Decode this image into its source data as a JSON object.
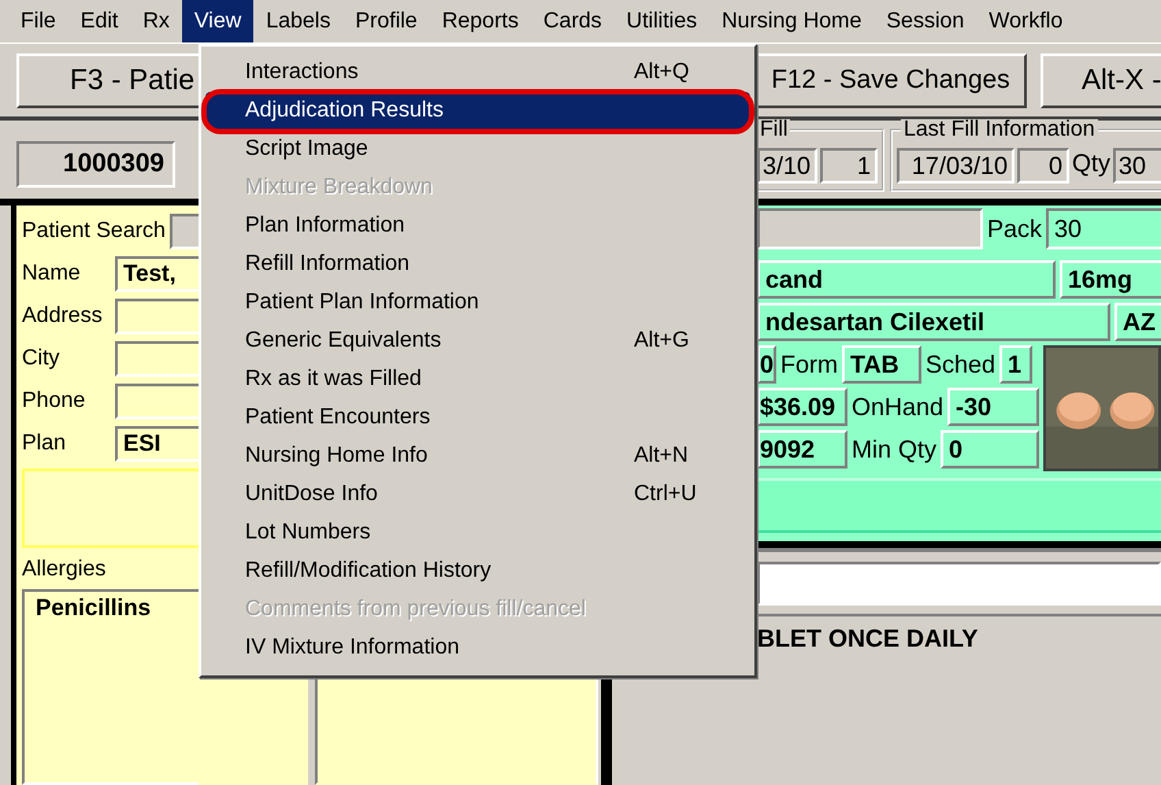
{
  "menu_bar": [
    {
      "label": "File",
      "selected": false
    },
    {
      "label": "Edit",
      "selected": false
    },
    {
      "label": "Rx",
      "selected": false
    },
    {
      "label": "View",
      "selected": true
    },
    {
      "label": "Labels",
      "selected": false
    },
    {
      "label": "Profile",
      "selected": false
    },
    {
      "label": "Reports",
      "selected": false
    },
    {
      "label": "Cards",
      "selected": false
    },
    {
      "label": "Utilities",
      "selected": false
    },
    {
      "label": "Nursing Home",
      "selected": false
    },
    {
      "label": "Session",
      "selected": false
    },
    {
      "label": "Workflo",
      "selected": false
    }
  ],
  "toolbar": {
    "buttons": [
      {
        "label": "F3 - Patie"
      },
      {
        "label": "F12 - Save Changes"
      },
      {
        "label": "Alt-X -"
      }
    ]
  },
  "view_menu": {
    "items": [
      {
        "label": "Interactions",
        "shortcut": "Alt+Q",
        "selected": false,
        "disabled": false,
        "highlighted": false
      },
      {
        "label": "Adjudication Results",
        "selected": true,
        "disabled": false,
        "highlighted": true
      },
      {
        "label": "Script Image",
        "selected": false,
        "disabled": false,
        "highlighted": false
      },
      {
        "label": "Mixture Breakdown",
        "selected": false,
        "disabled": true,
        "highlighted": false
      },
      {
        "label": "Plan Information",
        "selected": false,
        "disabled": false,
        "highlighted": false
      },
      {
        "label": "Refill Information",
        "selected": false,
        "disabled": false,
        "highlighted": false
      },
      {
        "label": "Patient Plan Information",
        "selected": false,
        "disabled": false,
        "highlighted": false
      },
      {
        "label": "Generic Equivalents",
        "shortcut": "Alt+G",
        "selected": false,
        "disabled": false,
        "highlighted": false
      },
      {
        "label": "Rx as it was Filled",
        "selected": false,
        "disabled": false,
        "highlighted": false
      },
      {
        "label": "Patient Encounters",
        "selected": false,
        "disabled": false,
        "highlighted": false
      },
      {
        "label": "Nursing Home Info",
        "shortcut": "Alt+N",
        "selected": false,
        "disabled": false,
        "highlighted": false
      },
      {
        "label": "UnitDose Info",
        "shortcut": "Ctrl+U",
        "selected": false,
        "disabled": false,
        "highlighted": false
      },
      {
        "label": "Lot Numbers",
        "selected": false,
        "disabled": false,
        "highlighted": false
      },
      {
        "label": "Refill/Modification History",
        "selected": false,
        "disabled": false,
        "highlighted": false
      },
      {
        "label": "Comments from previous fill/cancel",
        "selected": false,
        "disabled": true,
        "highlighted": false
      },
      {
        "label": "IV Mixture Information",
        "selected": false,
        "disabled": false,
        "highlighted": false
      }
    ]
  },
  "patient": {
    "rx_number": "1000309",
    "search_label": "Patient Search",
    "fields": [
      {
        "label": "Name",
        "value": "Test,"
      },
      {
        "label": "Address"
      },
      {
        "label": "City"
      },
      {
        "label": "Phone"
      },
      {
        "label": "Plan",
        "value": "ESI"
      }
    ],
    "allergies_label": "Allergies",
    "allergies": "Penicillins"
  },
  "fill": {
    "title": "Fill",
    "date": "3/10",
    "count": "1"
  },
  "last_fill": {
    "title": "Last Fill Information",
    "date": "17/03/10",
    "count": "0",
    "qty_label": "Qty",
    "qty": "30"
  },
  "drug": {
    "pack_label": "Pack",
    "pack": "30",
    "name": "cand",
    "strength": "16mg",
    "generic": "ndesartan Cilexetil",
    "manufacturer": "AZ",
    "code": "0",
    "form_label": "Form",
    "form": "TAB",
    "sched_label": "Sched",
    "sched": "1",
    "price": "$36.09",
    "onhand_label": "OnHand",
    "onhand": "-30",
    "din": "9092",
    "min_qty_label": "Min Qty",
    "min_qty": "0"
  },
  "sig": "BLET ONCE DAILY"
}
